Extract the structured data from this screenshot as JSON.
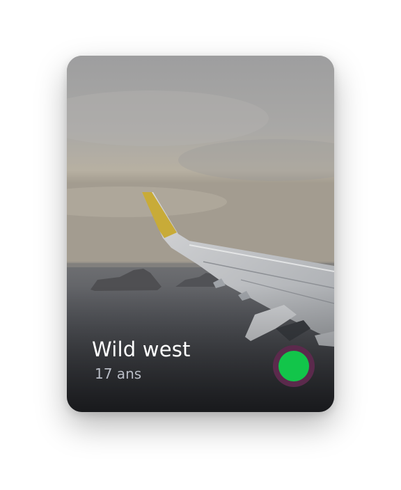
{
  "profile": {
    "name": "Wild west",
    "age": "17 ans"
  },
  "photo": {
    "subject": "airplane-wing-over-sea"
  },
  "status": {
    "color": "#12c54a",
    "ring_color": "#5b2a4c"
  }
}
